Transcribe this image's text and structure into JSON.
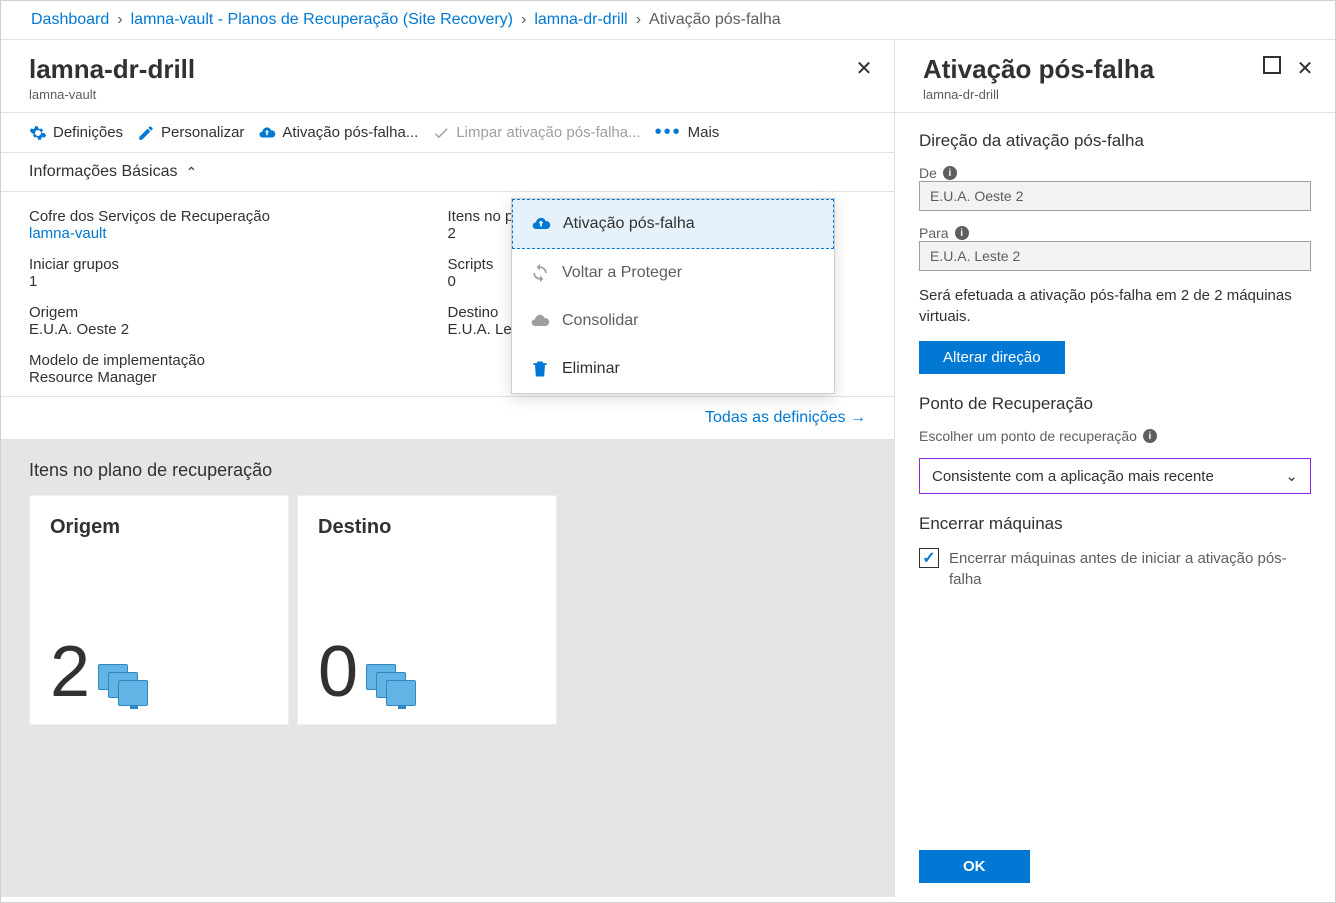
{
  "breadcrumb": {
    "items": [
      "Dashboard",
      "lamna-vault - Planos de Recuperação (Site Recovery)",
      "lamna-dr-drill"
    ],
    "current": "Ativação pós-falha"
  },
  "left": {
    "title": "lamna-dr-drill",
    "subtitle": "lamna-vault"
  },
  "toolbar": {
    "settings": "Definições",
    "customize": "Personalizar",
    "failover": "Ativação pós-falha...",
    "cleanup": "Limpar ativação pós-falha...",
    "more": "Mais"
  },
  "essentials": {
    "header": "Informações Básicas",
    "col1": {
      "vault_label": "Cofre dos Serviços de Recuperação",
      "vault_value": "lamna-vault",
      "groups_label": "Iniciar grupos",
      "groups_value": "1",
      "source_label": "Origem",
      "source_value": "E.U.A. Oeste 2",
      "model_label": "Modelo de implementação",
      "model_value": "Resource Manager"
    },
    "col2": {
      "items_label": "Itens no pla",
      "items_value": "2",
      "scripts_label": "Scripts",
      "scripts_value": "0",
      "dest_label": "Destino",
      "dest_value": "E.U.A. Lest"
    },
    "all_settings": "Todas as definições"
  },
  "tiles": {
    "header": "Itens no plano de recuperação",
    "source": {
      "title": "Origem",
      "count": "2"
    },
    "dest": {
      "title": "Destino",
      "count": "0"
    }
  },
  "menu": {
    "failover": "Ativação pós-falha",
    "reprotect": "Voltar a Proteger",
    "commit": "Consolidar",
    "delete": "Eliminar"
  },
  "right": {
    "title": "Ativação pós-falha",
    "subtitle": "lamna-dr-drill",
    "direction_header": "Direção da ativação pós-falha",
    "from_label": "De",
    "from_value": "E.U.A. Oeste 2",
    "to_label": "Para",
    "to_value": "E.U.A. Leste 2",
    "note": "Será efetuada a ativação pós-falha em 2 de 2 máquinas virtuais.",
    "change_direction": "Alterar direção",
    "recovery_header": "Ponto de Recuperação",
    "recovery_label": "Escolher um ponto de recuperação",
    "recovery_value": "Consistente com a aplicação mais recente",
    "shutdown_header": "Encerrar máquinas",
    "shutdown_label": "Encerrar máquinas antes de iniciar a ativação pós-falha",
    "ok": "OK"
  }
}
